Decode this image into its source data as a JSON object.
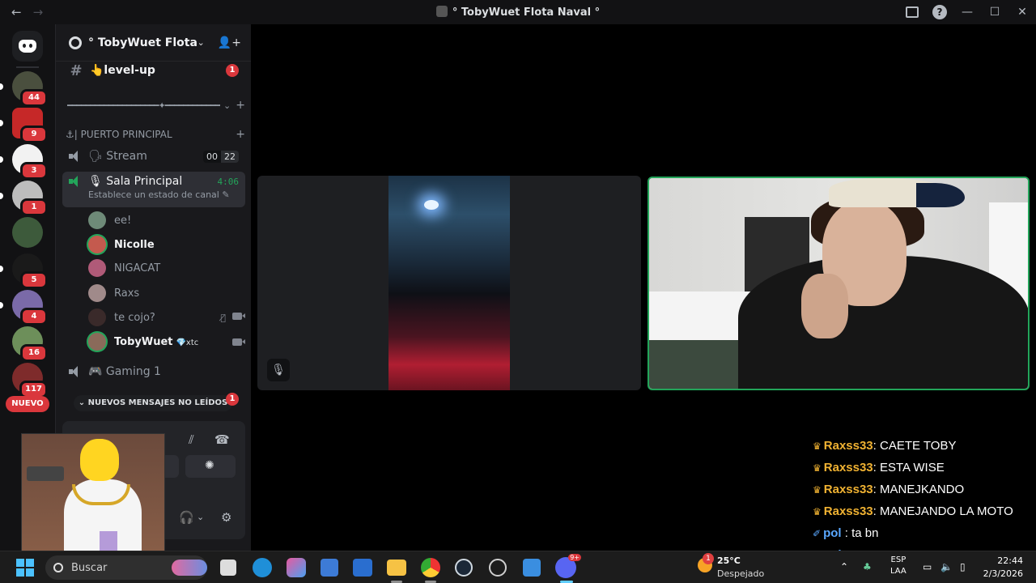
{
  "window": {
    "title": "° TobyWuet Flota Naval °",
    "back_arrow": "←",
    "forward_arrow": "→"
  },
  "guilds": {
    "badges": [
      "44",
      "9",
      "3",
      "1",
      "",
      "5",
      "4",
      "16",
      "117"
    ],
    "nuevo_label": "NUEVO"
  },
  "server": {
    "name": "° TobyWuet Flota ...",
    "channels": {
      "levelup": {
        "name": "👆level-up",
        "badge": "1"
      },
      "divider": "━━━━━━━━━━━━━━━━━━━━✦━━━━━━━━━━━━━...",
      "category": "⚓| PUERTO PRINCIPAL",
      "stream": {
        "name": "🗣 Stream",
        "count_a": "00",
        "count_b": "22"
      },
      "sala": {
        "name": "🎙 Sala Principal",
        "timer": "4:06",
        "status": "Establece un estado de canal ✎"
      },
      "gaming": {
        "name": "🎮 Gaming 1"
      }
    },
    "members": [
      {
        "name": "ee!",
        "bold": false
      },
      {
        "name": "Nicolle",
        "bold": true
      },
      {
        "name": "NIGACAT",
        "bold": false
      },
      {
        "name": "Raxs",
        "bold": false
      },
      {
        "name": "te cojo?",
        "bold": false
      },
      {
        "name": "TobyWuet",
        "bold": true,
        "tag": "💎xtc"
      }
    ],
    "new_messages": "⌄ NUEVOS MENSAJES NO LEÍDOS",
    "new_messages_badge": "1"
  },
  "chat_overlay": [
    {
      "user": "Raxss33",
      "text": ": CAETE TOBY"
    },
    {
      "user": "Raxss33",
      "text": ": ESTA WISE"
    },
    {
      "user": "Raxss33",
      "text": ": MANEJKANDO"
    },
    {
      "user": "Raxss33",
      "text": ": MANEJANDO LA MOTO"
    },
    {
      "user": "pol",
      "text": " : ta bn"
    },
    {
      "user": "pol",
      "text": " :"
    }
  ],
  "taskbar": {
    "search_placeholder": "Buscar",
    "weather_temp": "25°C",
    "weather_condition": "Despejado",
    "weather_badge": "1",
    "lang": "ESP",
    "layout": "LAA",
    "time": "22:44",
    "date": "2/3/2026",
    "discord_badge": "9+"
  }
}
